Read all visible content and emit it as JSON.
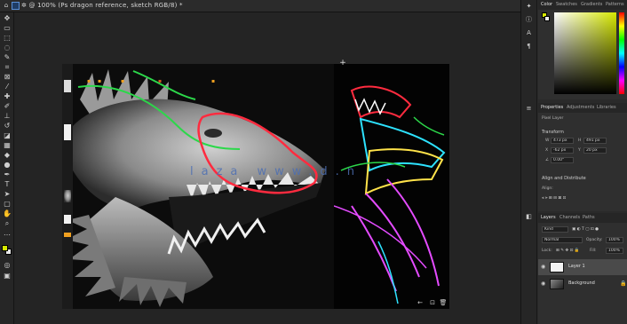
{
  "window": {
    "title": "✲ @ 100% (Ps dragon reference, sketch RGB/8) *",
    "accent": "#d6e800"
  },
  "titlebar_icons": [
    "home-icon",
    "minimize-icon",
    "maximize-icon",
    "close-icon"
  ],
  "colors": {
    "fg_swatch": "#d6e800",
    "bg_swatch": "#eaeaea",
    "glow_red": "#ff2b3f",
    "glow_green": "#2cd84a",
    "glow_yellow": "#ffe34a",
    "glow_magenta": "#e44bff",
    "glow_cyan": "#2de2ff",
    "watermark": "#4d6fb3"
  },
  "watermark": "laza www.d.n",
  "color_panel": {
    "tabs": [
      "Color",
      "Swatches",
      "Gradients",
      "Patterns"
    ]
  },
  "properties_panel": {
    "tabs": [
      "Properties",
      "Adjustments",
      "Libraries"
    ],
    "layer_label": "Pixel Layer",
    "transform_label": "Transform",
    "w": "473 px",
    "h": "491 px",
    "x": "-62 px",
    "y": "20 px",
    "angle": "0.00°",
    "align_label": "Align and Distribute",
    "align_sub": "Align:"
  },
  "layers_panel": {
    "tabs": [
      "Layers",
      "Channels",
      "Paths"
    ],
    "kind_label": "Kind",
    "blend_mode": "Normal",
    "opacity_label": "Opacity:",
    "opacity_value": "100%",
    "lock_label": "Lock:",
    "fill_label": "Fill:",
    "fill_value": "100%",
    "layers": [
      {
        "name": "Layer 1",
        "selected": true
      },
      {
        "name": "Background",
        "selected": false,
        "locked": true
      }
    ]
  },
  "bottom_doc_icons": [
    "undo-icon",
    "crop-icon",
    "trash-icon"
  ]
}
